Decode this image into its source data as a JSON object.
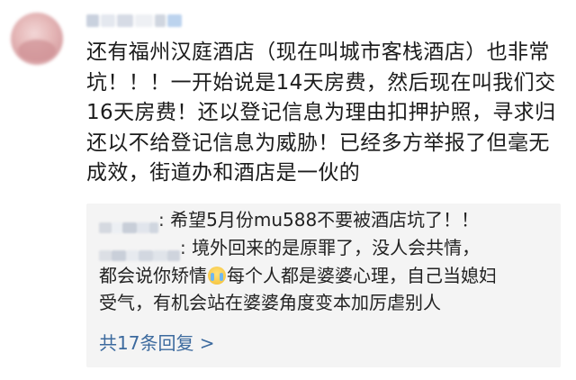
{
  "comment": {
    "avatar_icon": "avatar-icon",
    "text": "还有福州汉庭酒店（现在叫城市客栈酒店）也非常\n坑！！！一开始说是14天房费，然后现在叫我们交\n16天房费！还以登记信息为理由扣押护照，寻求归\n还以不给登记信息为威胁！已经多方举报了但毫无\n成效，街道办和酒店是一伙的"
  },
  "replies": {
    "items": [
      {
        "text": "希望5月份mu588不要被酒店坑了！！"
      },
      {
        "text_before_emoji": "境外回来的是原罪了，没人会共情，\n都会说你矫情",
        "emoji": "crying-face-emoji",
        "text_after_emoji": "每个人都是婆婆心理，自己当媳妇\n受气，有机会站在婆婆角度变本加厉虐别人"
      }
    ],
    "more_label": "共17条回复 >"
  },
  "colors": {
    "link": "#3c6a9e",
    "reply_bg": "#f4f4f4",
    "text": "#1c1c1c"
  }
}
